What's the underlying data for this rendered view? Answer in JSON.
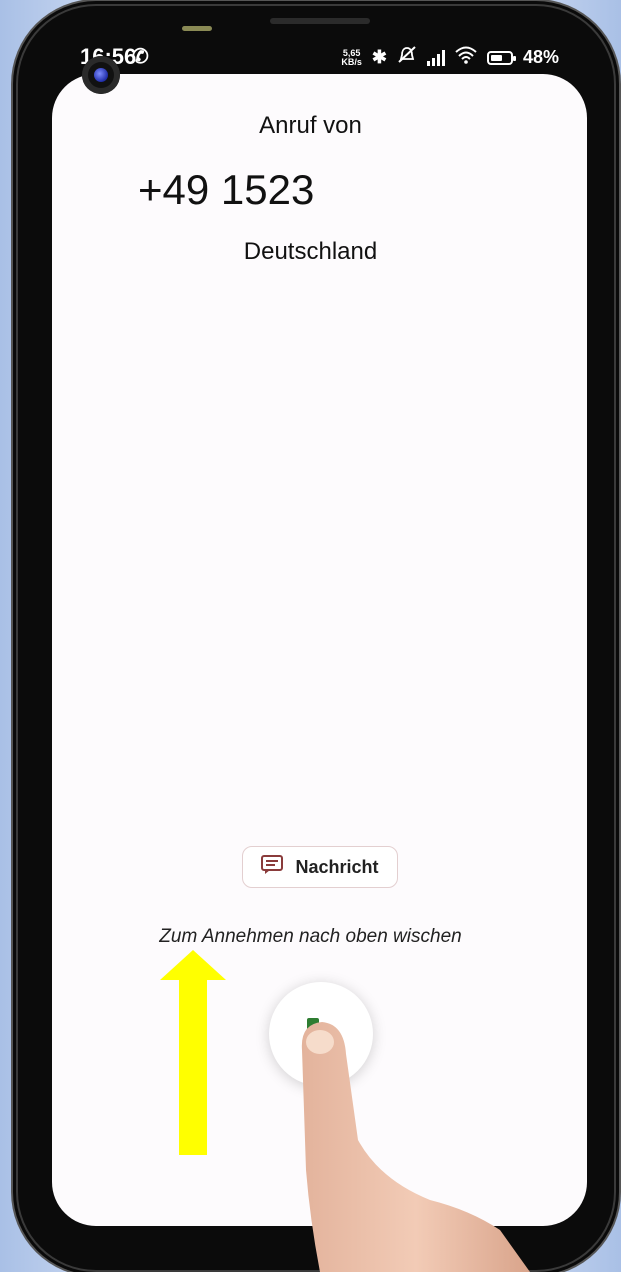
{
  "status_bar": {
    "time": "16:56",
    "net_speed_value": "5,65",
    "net_speed_unit": "KB/s",
    "battery_percent": "48%",
    "icons": [
      "phone-icon",
      "bluetooth-icon",
      "mute-icon",
      "signal-icon",
      "wifi-icon",
      "battery-icon"
    ]
  },
  "call": {
    "heading": "Anruf von",
    "number": "+49 1523",
    "location": "Deutschland"
  },
  "actions": {
    "message_label": "Nachricht",
    "swipe_hint": "Zum Annehmen nach oben wischen"
  },
  "colors": {
    "screen_bg": "#fdfbfd",
    "arrow": "#ffff00",
    "message_icon": "#8a3b3b",
    "answer_accent": "#2e7d32"
  }
}
